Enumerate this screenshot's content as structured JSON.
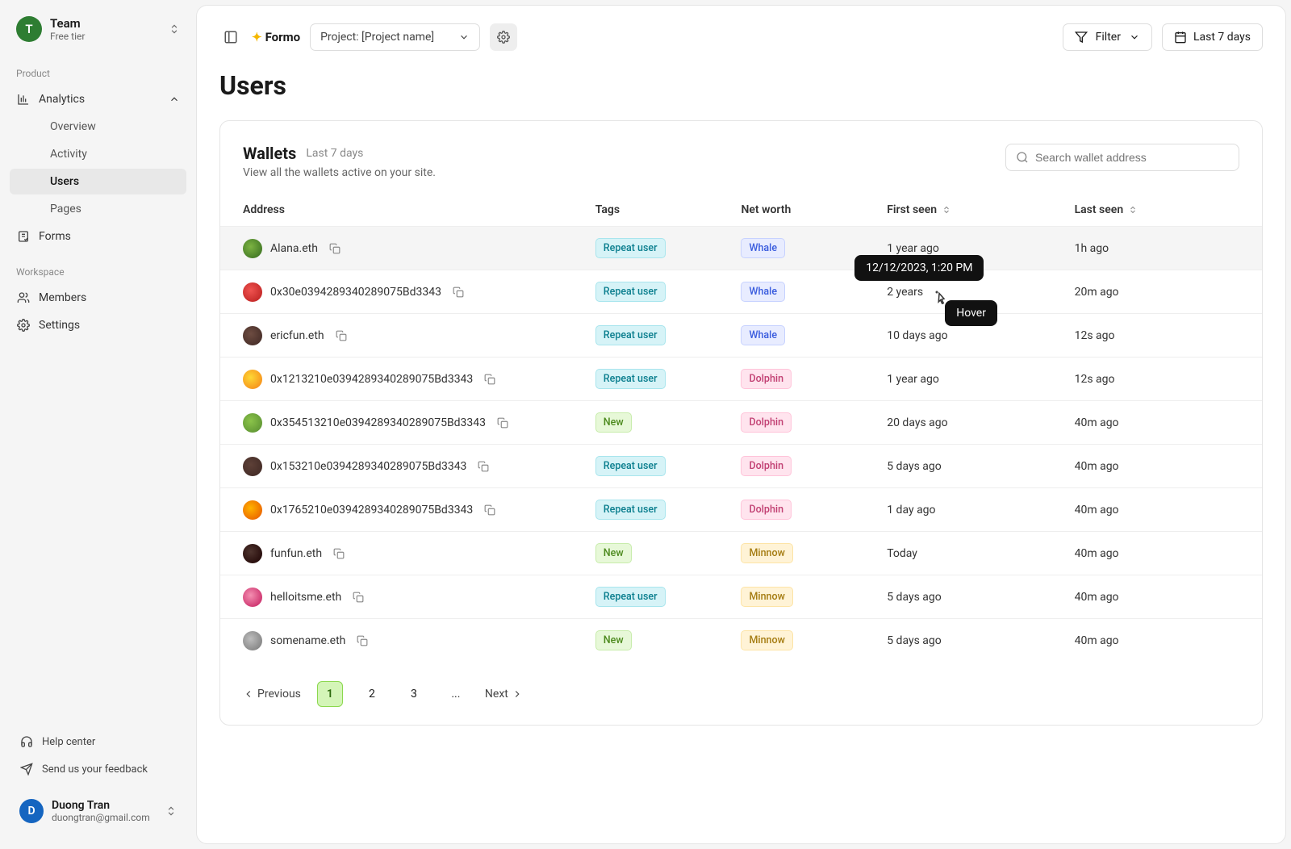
{
  "sidebar": {
    "team": {
      "initial": "T",
      "name": "Team",
      "tier": "Free tier"
    },
    "sections": {
      "product_label": "Product",
      "workspace_label": "Workspace"
    },
    "nav": {
      "analytics": "Analytics",
      "analytics_sub": [
        "Overview",
        "Activity",
        "Users",
        "Pages"
      ],
      "forms": "Forms",
      "members": "Members",
      "settings": "Settings"
    },
    "help": "Help center",
    "feedback": "Send us your feedback",
    "user": {
      "initial": "D",
      "name": "Duong Tran",
      "email": "duongtran@gmail.com"
    }
  },
  "topbar": {
    "brand": "Formo",
    "project_label": "Project: [Project name]",
    "filter": "Filter",
    "date_range": "Last 7 days"
  },
  "page": {
    "title": "Users"
  },
  "wallets": {
    "title": "Wallets",
    "period": "Last 7 days",
    "desc": "View all the wallets active on your site.",
    "search_placeholder": "Search wallet address",
    "columns": {
      "address": "Address",
      "tags": "Tags",
      "networth": "Net worth",
      "firstseen": "First seen",
      "lastseen": "Last seen"
    },
    "rows": [
      {
        "address": "Alana.eth",
        "tag": "Repeat user",
        "worth": "Whale",
        "first": "1 year ago",
        "last": "1h ago"
      },
      {
        "address": "0x30e0394289340289075Bd3343",
        "tag": "Repeat user",
        "worth": "Whale",
        "first": "2 years",
        "last": "20m ago"
      },
      {
        "address": "ericfun.eth",
        "tag": "Repeat user",
        "worth": "Whale",
        "first": "10 days ago",
        "last": "12s ago"
      },
      {
        "address": "0x1213210e0394289340289075Bd3343",
        "tag": "Repeat user",
        "worth": "Dolphin",
        "first": "1 year ago",
        "last": "12s ago"
      },
      {
        "address": "0x354513210e0394289340289075Bd3343",
        "tag": "New",
        "worth": "Dolphin",
        "first": "20 days ago",
        "last": "40m ago"
      },
      {
        "address": "0x153210e0394289340289075Bd3343",
        "tag": "Repeat user",
        "worth": "Dolphin",
        "first": "5 days ago",
        "last": "40m ago"
      },
      {
        "address": "0x1765210e0394289340289075Bd3343",
        "tag": "Repeat user",
        "worth": "Dolphin",
        "first": "1 day ago",
        "last": "40m ago"
      },
      {
        "address": "funfun.eth",
        "tag": "New",
        "worth": "Minnow",
        "first": "Today",
        "last": "40m ago"
      },
      {
        "address": "helloitsme.eth",
        "tag": "Repeat user",
        "worth": "Minnow",
        "first": "5 days ago",
        "last": "40m ago"
      },
      {
        "address": "somename.eth",
        "tag": "New",
        "worth": "Minnow",
        "first": "5 days ago",
        "last": "40m ago"
      }
    ],
    "tooltip_date": "12/12/2023, 1:20 PM",
    "tooltip_hover": "Hover"
  },
  "pagination": {
    "prev": "Previous",
    "pages": [
      "1",
      "2",
      "3"
    ],
    "ellipsis": "...",
    "next": "Next"
  }
}
